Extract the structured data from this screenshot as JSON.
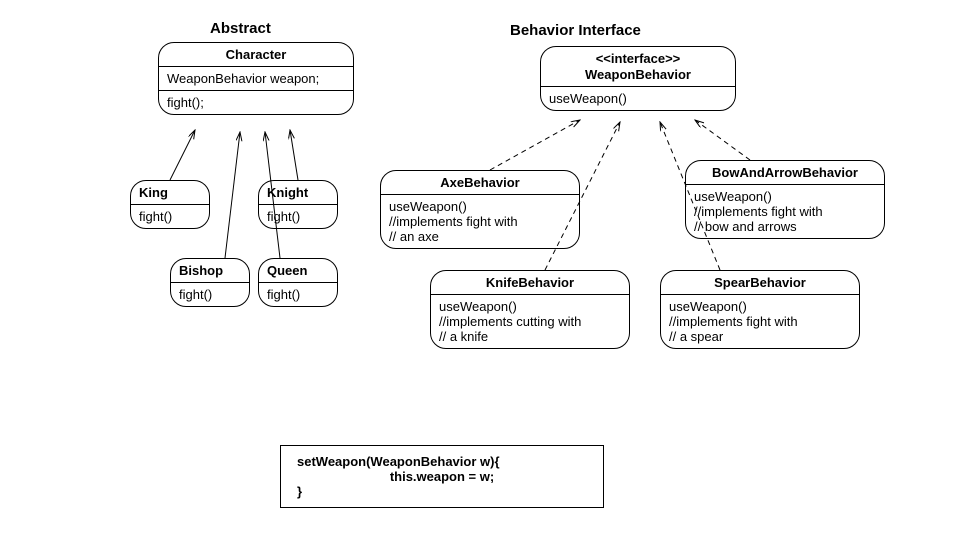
{
  "titles": {
    "abstract": "Abstract",
    "interface": "Behavior Interface"
  },
  "character": {
    "name": "Character",
    "field": "WeaponBehavior weapon;",
    "method": "fight();"
  },
  "weaponBehavior": {
    "stereotype": "<<interface>>",
    "name": "WeaponBehavior",
    "method": "useWeapon()"
  },
  "subs": {
    "king": {
      "name": "King",
      "method": "fight()"
    },
    "knight": {
      "name": "Knight",
      "method": "fight()"
    },
    "bishop": {
      "name": "Bishop",
      "method": "fight()"
    },
    "queen": {
      "name": "Queen",
      "method": "fight()"
    }
  },
  "behaviors": {
    "axe": {
      "name": "AxeBehavior",
      "body": "useWeapon()\n//implements fight with\n// an axe"
    },
    "bow": {
      "name": "BowAndArrowBehavior",
      "body": "useWeapon()\n//implements fight with\n// bow and arrows"
    },
    "knife": {
      "name": "KnifeBehavior",
      "body": "useWeapon()\n//implements cutting with\n// a knife"
    },
    "spear": {
      "name": "SpearBehavior",
      "body": "useWeapon()\n//implements fight with\n// a spear"
    }
  },
  "snippet": {
    "line1": "setWeapon(WeaponBehavior w){",
    "line2": "this.weapon = w;",
    "line3": "}"
  },
  "chart_data": {
    "type": "table",
    "description": "UML class diagram: Strategy pattern for weapon behavior",
    "abstract_class": {
      "name": "Character",
      "fields": [
        "WeaponBehavior weapon"
      ],
      "methods": [
        "fight()"
      ],
      "subclasses": [
        "King",
        "Knight",
        "Bishop",
        "Queen"
      ]
    },
    "interface": {
      "name": "WeaponBehavior",
      "methods": [
        "useWeapon()"
      ],
      "implementations": [
        "AxeBehavior",
        "BowAndArrowBehavior",
        "KnifeBehavior",
        "SpearBehavior"
      ]
    },
    "setter": "setWeapon(WeaponBehavior w){ this.weapon = w; }"
  }
}
